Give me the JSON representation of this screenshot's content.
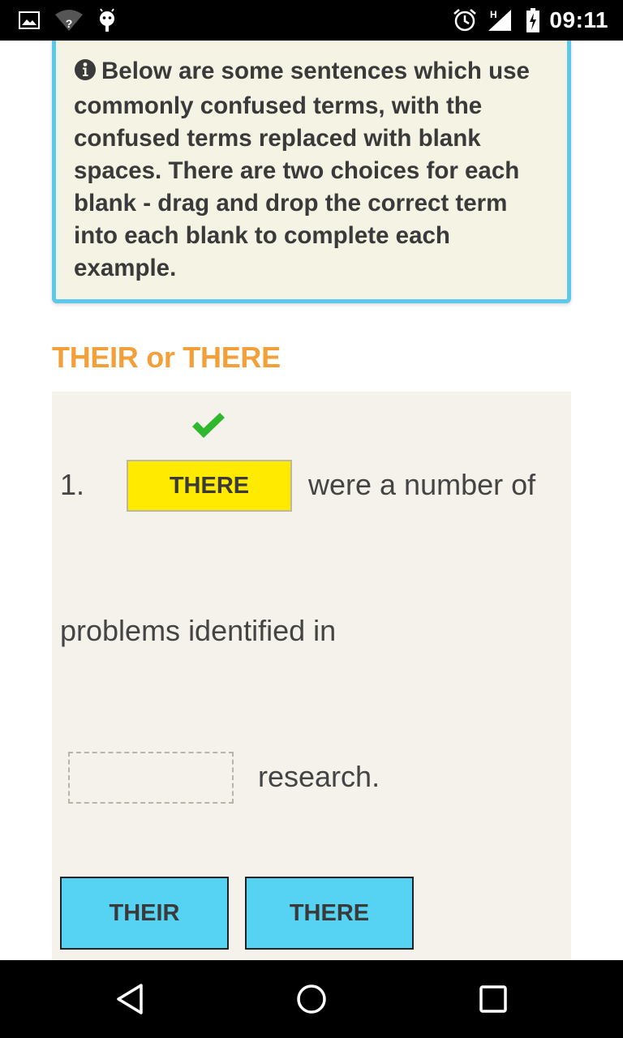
{
  "status_bar": {
    "time": "09:11",
    "icons": [
      "gallery-icon",
      "wifi-unknown-icon",
      "android-debug-icon",
      "alarm-icon",
      "signal-h-icon",
      "battery-charging-icon"
    ],
    "signal_label": "H",
    "wifi_label": "?"
  },
  "info_box": {
    "icon": "info-circle-icon",
    "text": "Below are some sentences which use commonly confused terms, with the confused terms replaced with blank spaces. There are two choices for each blank - drag and drop the correct term into each blank to complete each example.",
    "border_color": "#5bc8ec",
    "background": "#f5f3e3"
  },
  "section": {
    "heading": "THEIR or THERE",
    "heading_color": "#f3a03a"
  },
  "exercise": {
    "number": "1.",
    "blank1_answer": "THERE",
    "blank1_correct": true,
    "text_after_blank1": "were a number of",
    "text_line2": "problems identified in",
    "blank2_answer": "",
    "text_after_blank2": "research.",
    "choices": [
      "THEIR",
      "THERE"
    ],
    "colors": {
      "filled_blank": "#ffea00",
      "choice": "#56d2f2",
      "check": "#2eb82e"
    }
  },
  "nav_bar": {
    "buttons": [
      "back-icon",
      "home-icon",
      "recents-icon"
    ]
  }
}
